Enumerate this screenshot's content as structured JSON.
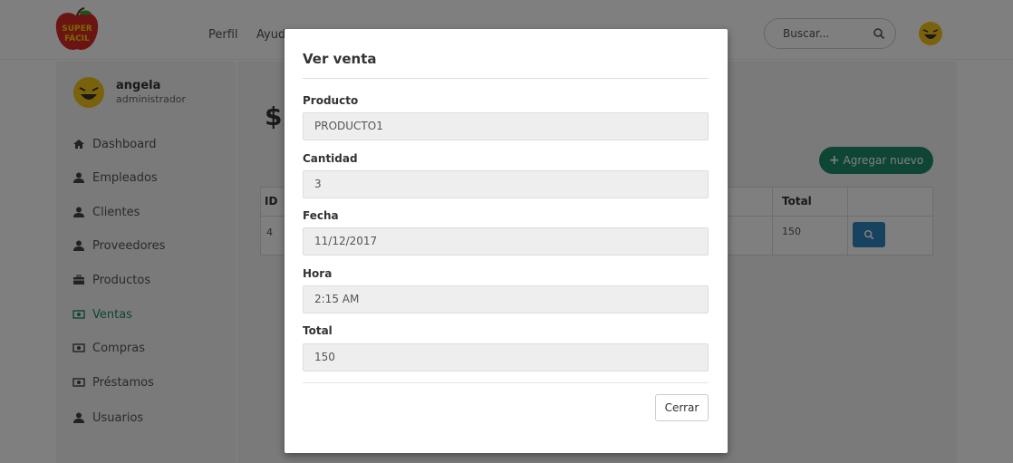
{
  "colors": {
    "accent": "#1f8a6b",
    "view_button": "#2e86c1",
    "logo_red": "#d62828",
    "logo_text": "#f7d200"
  },
  "header": {
    "logo_text_top": "SUPER",
    "logo_text_bottom": "FÁCIL",
    "nav": [
      "Perfil",
      "Ayuda"
    ],
    "search_placeholder": "Buscar...",
    "search_icon": "search-icon",
    "avatar_icon": "laughing-face-icon"
  },
  "sidebar": {
    "user": {
      "name": "angela",
      "role": "administrador",
      "avatar_icon": "laughing-face-icon"
    },
    "items": [
      {
        "label": "Dashboard",
        "icon": "home-icon"
      },
      {
        "label": "Empleados",
        "icon": "user-icon"
      },
      {
        "label": "Clientes",
        "icon": "user-icon"
      },
      {
        "label": "Proveedores",
        "icon": "user-icon"
      },
      {
        "label": "Productos",
        "icon": "briefcase-icon"
      },
      {
        "label": "Ventas",
        "icon": "money-icon",
        "active": true
      },
      {
        "label": "Compras",
        "icon": "money-icon"
      },
      {
        "label": "Préstamos",
        "icon": "money-icon"
      },
      {
        "label": "Usuarios",
        "icon": "user-icon"
      }
    ]
  },
  "main": {
    "heading_symbol": "$",
    "add_button": {
      "icon": "plus-icon",
      "label": "Agregar nuevo"
    },
    "table": {
      "headers": {
        "id": "ID",
        "total": "Total"
      },
      "rows": [
        {
          "id": "4",
          "total": "150",
          "action_icon": "search-icon"
        }
      ]
    }
  },
  "modal": {
    "title": "Ver venta",
    "fields": [
      {
        "label": "Producto",
        "value": "PRODUCTO1"
      },
      {
        "label": "Cantidad",
        "value": "3"
      },
      {
        "label": "Fecha",
        "value": "11/12/2017"
      },
      {
        "label": "Hora",
        "value": "2:15 AM"
      },
      {
        "label": "Total",
        "value": "150"
      }
    ],
    "close_label": "Cerrar"
  }
}
